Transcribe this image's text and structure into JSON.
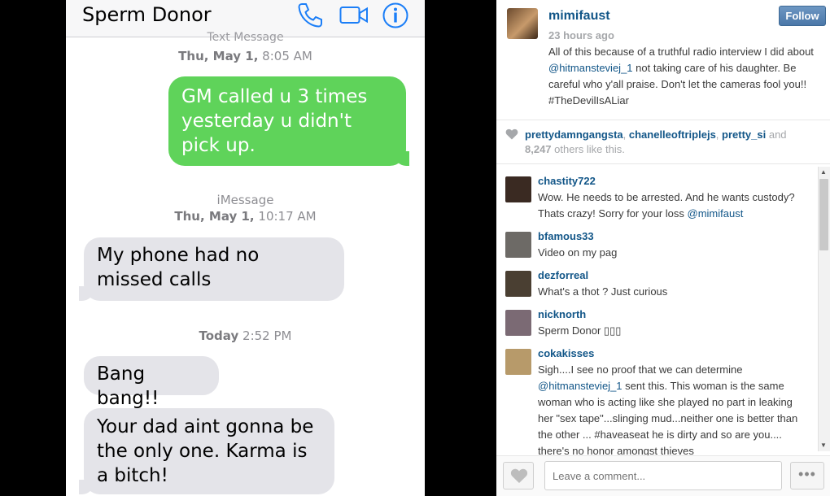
{
  "photo": {
    "contact_name": "Sperm Donor",
    "icons": [
      "phone-icon",
      "video-icon",
      "info-icon"
    ],
    "timestamp1_type": "Text Message",
    "timestamp1_day": "Thu, May 1,",
    "timestamp1_time": "8:05 AM",
    "sent_message": "GM called u 3 times yesterday u didn't pick up.",
    "timestamp2_type": "iMessage",
    "timestamp2_day": "Thu, May 1,",
    "timestamp2_time": "10:17 AM",
    "received_message_1": "My phone had no missed calls",
    "timestamp3_day": "Today",
    "timestamp3_time": "2:52 PM",
    "received_message_2": "Bang bang!!",
    "received_message_3": "Your dad aint gonna be the only one. Karma is a bitch!",
    "colors": {
      "sent_bubble": "#5fd35a",
      "received_bubble": "#e4e4e9",
      "icon_blue": "#1b7ef7"
    }
  },
  "post": {
    "author": "mimifaust",
    "time": "23 hours ago",
    "follow_label": "Follow",
    "caption_pre": "All of this because of a truthful radio interview I did about ",
    "caption_mention": "@hitmansteviej_1",
    "caption_post": " not taking care of his daughter. Be careful who y'all praise. Don't let the cameras fool you!! #TheDevilIsALiar"
  },
  "likes": {
    "users": [
      "prettydamngangsta",
      "chanelleoftriplejs",
      "pretty_si"
    ],
    "sep1": ", ",
    "sep2": ", ",
    "and_text": " and ",
    "count": "8,247",
    "suffix": " others like this."
  },
  "comments": [
    {
      "user": "chastity722",
      "text": "Wow. He needs to be arrested. And he wants custody? Thats crazy! Sorry for your loss ",
      "mention": "@mimifaust",
      "avatar_color": "#3a2a22"
    },
    {
      "user": "bfamous33",
      "text": "Video on my pag",
      "mention": "",
      "avatar_color": "#6d6a66"
    },
    {
      "user": "dezforreal",
      "text": "What's a thot ? Just curious",
      "mention": "",
      "avatar_color": "#4a3f32"
    },
    {
      "user": "nicknorth",
      "text": "Sperm Donor ▯▯▯",
      "mention": "",
      "avatar_color": "#7b6a74"
    },
    {
      "user": "cokakisses",
      "text_pre": "Sigh....I see no proof that we can determine ",
      "mention": "@hitmansteviej_1",
      "text": " sent this. This woman is the same woman who is acting like she played no part in leaking her \"sex tape\"...slinging mud...neither one is better than the other ... #haveaseat he is dirty and so are you.... there's no honor amongst thieves",
      "avatar_color": "#b79a6a"
    }
  ],
  "footer": {
    "comment_placeholder": "Leave a comment...",
    "more_label": "•••"
  },
  "colors": {
    "link_blue": "#125688",
    "follow_blue": "#4b77a8",
    "meta_gray": "#a5a7aa"
  }
}
